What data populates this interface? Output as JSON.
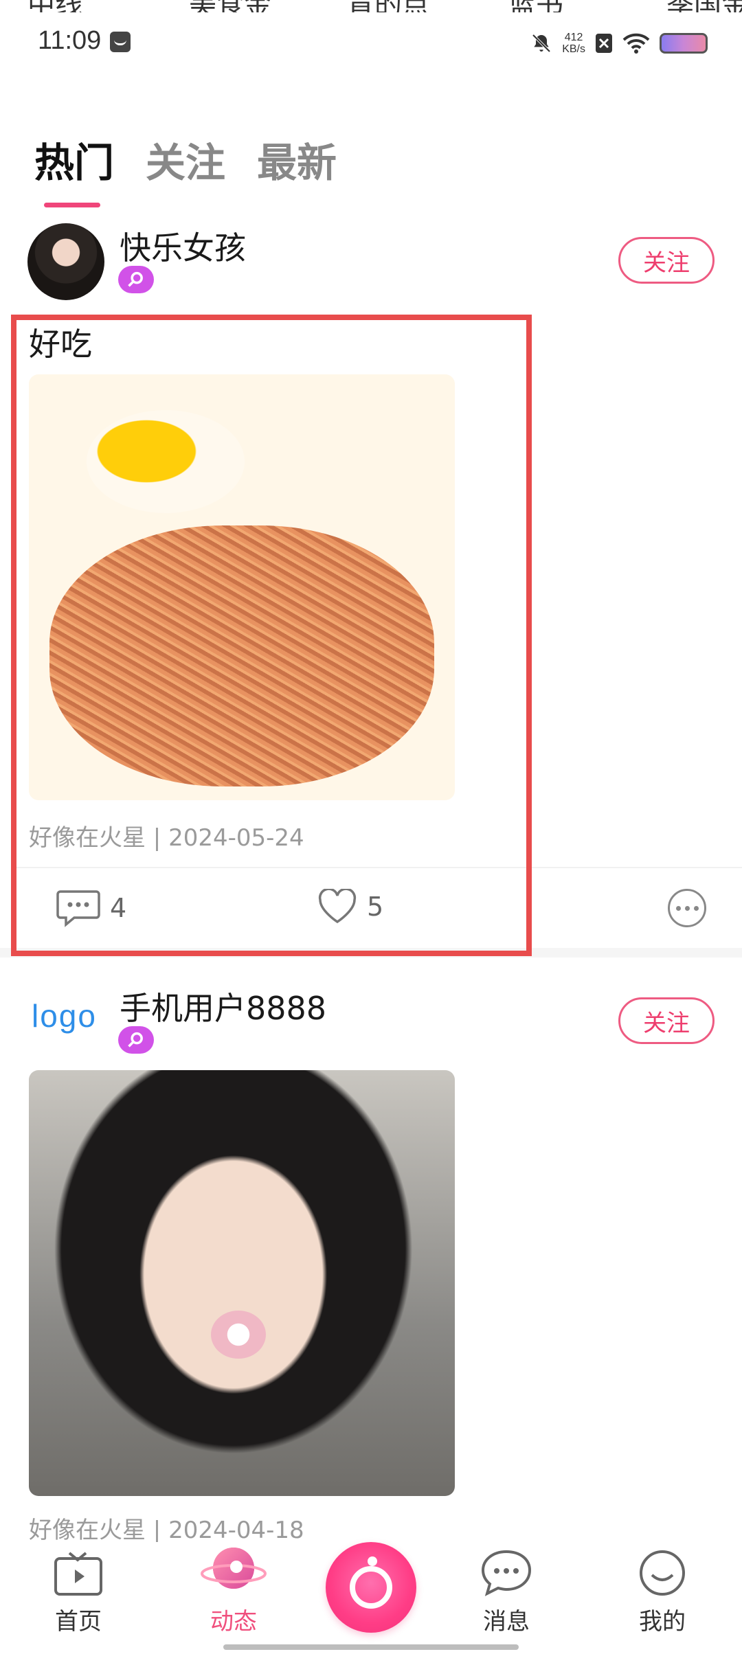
{
  "top_cut_text": [
    "中线",
    "美食金",
    "肯的点",
    "蓝书",
    "季国金"
  ],
  "status": {
    "time": "11:09",
    "speed_value": "412",
    "speed_unit": "KB/s"
  },
  "tabs": [
    {
      "label": "热门",
      "active": true
    },
    {
      "label": "关注",
      "active": false
    },
    {
      "label": "最新",
      "active": false
    }
  ],
  "posts": [
    {
      "username": "快乐女孩",
      "follow_label": "关注",
      "text": "好吃",
      "image": "food-photo",
      "meta": "好像在火星 | 2024-05-24",
      "comments": "4",
      "likes": "5"
    },
    {
      "avatar_text": "logo",
      "username": "手机用户8888",
      "follow_label": "关注",
      "image": "portrait-photo",
      "meta": "好像在火星 | 2024-04-18"
    }
  ],
  "nav": {
    "home": "首页",
    "feed": "动态",
    "messages": "消息",
    "me": "我的"
  },
  "colors": {
    "accent": "#f0457a",
    "badge": "#d152e8",
    "highlight": "#e84c4c",
    "logo": "#2e8ee8"
  }
}
